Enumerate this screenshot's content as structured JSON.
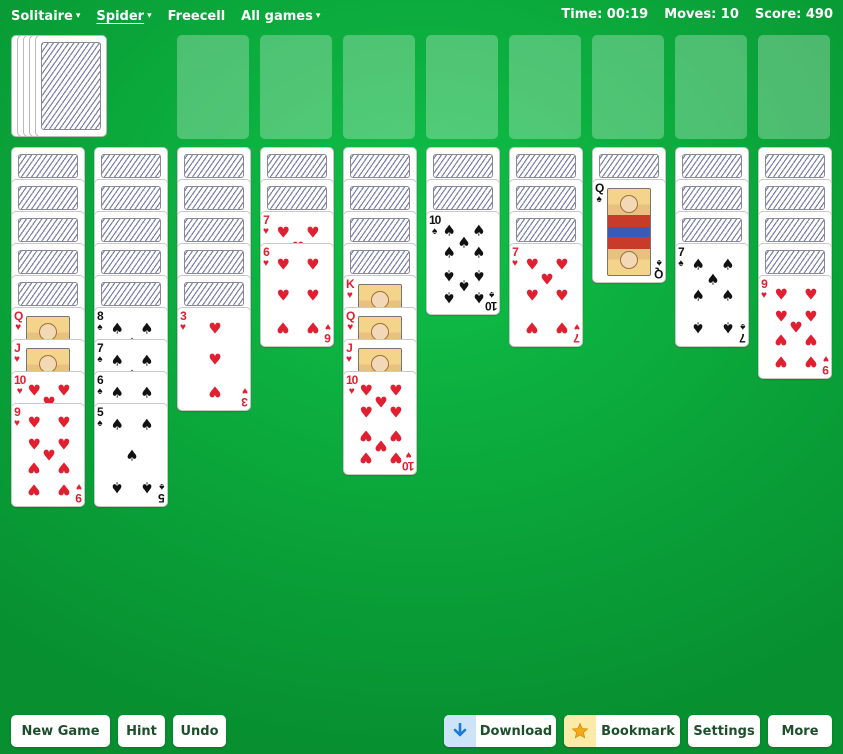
{
  "nav": {
    "items": [
      {
        "label": "Solitaire",
        "caret": "▾"
      },
      {
        "label": "Spider",
        "caret": "▾"
      },
      {
        "label": "Freecell",
        "caret": ""
      },
      {
        "label": "All games",
        "caret": "▾"
      }
    ]
  },
  "stats": {
    "time": "Time: 00:19",
    "moves": "Moves: 10",
    "score": "Score: 490"
  },
  "stock": {
    "remaining_deals": 5
  },
  "foundations": {
    "count": 8
  },
  "tableau": [
    {
      "face_down": 5,
      "face_up": [
        {
          "rank": "Q",
          "suit": "♥"
        },
        {
          "rank": "J",
          "suit": "♥"
        },
        {
          "rank": "10",
          "suit": "♥"
        },
        {
          "rank": "9",
          "suit": "♥"
        }
      ]
    },
    {
      "face_down": 5,
      "face_up": [
        {
          "rank": "8",
          "suit": "♠"
        },
        {
          "rank": "7",
          "suit": "♠"
        },
        {
          "rank": "6",
          "suit": "♠"
        },
        {
          "rank": "5",
          "suit": "♠"
        }
      ]
    },
    {
      "face_down": 5,
      "face_up": [
        {
          "rank": "3",
          "suit": "♥"
        }
      ]
    },
    {
      "face_down": 2,
      "face_up": [
        {
          "rank": "7",
          "suit": "♥"
        },
        {
          "rank": "6",
          "suit": "♥"
        }
      ]
    },
    {
      "face_down": 4,
      "face_up": [
        {
          "rank": "K",
          "suit": "♥"
        },
        {
          "rank": "Q",
          "suit": "♥"
        },
        {
          "rank": "J",
          "suit": "♥"
        },
        {
          "rank": "10",
          "suit": "♥"
        }
      ]
    },
    {
      "face_down": 2,
      "face_up": [
        {
          "rank": "10",
          "suit": "♠"
        }
      ]
    },
    {
      "face_down": 3,
      "face_up": [
        {
          "rank": "7",
          "suit": "♥"
        }
      ]
    },
    {
      "face_down": 1,
      "face_up": [
        {
          "rank": "Q",
          "suit": "♠"
        }
      ]
    },
    {
      "face_down": 3,
      "face_up": [
        {
          "rank": "7",
          "suit": "♠"
        }
      ]
    },
    {
      "face_down": 4,
      "face_up": [
        {
          "rank": "9",
          "suit": "♥"
        }
      ]
    }
  ],
  "buttons": {
    "new_game": "New Game",
    "hint": "Hint",
    "undo": "Undo",
    "download": "Download",
    "bookmark": "Bookmark",
    "settings": "Settings",
    "more": "More"
  },
  "icons": {
    "download": "download-arrow-icon",
    "bookmark": "star-icon"
  },
  "colors": {
    "felt": "#0aa53a",
    "red_suit": "#e02030",
    "black_suit": "#111111",
    "button_text": "#1e4f2c"
  }
}
